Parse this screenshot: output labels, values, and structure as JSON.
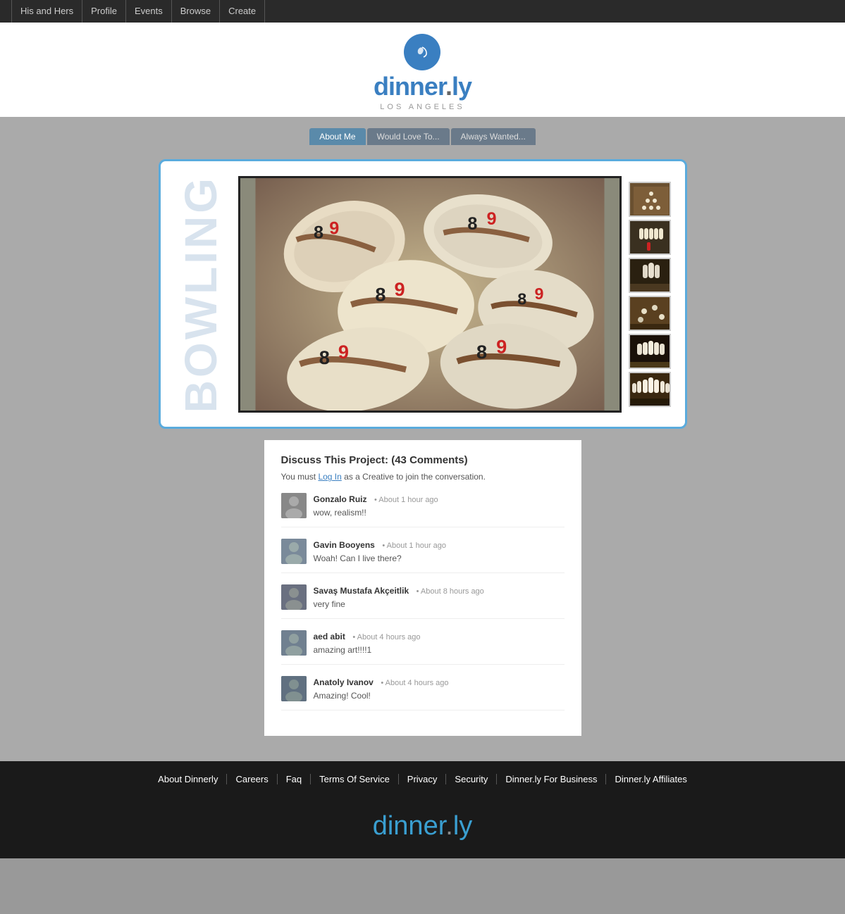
{
  "nav": {
    "brand": "His and Hers",
    "links": [
      "Profile",
      "Events",
      "Browse",
      "Create"
    ]
  },
  "header": {
    "logo_text": "dinner.ly",
    "logo_dot": ".",
    "location": "LOS ANGELES"
  },
  "profile_tabs": {
    "tabs": [
      "About Me",
      "Would Love To...",
      "Always Wanted..."
    ]
  },
  "lightbox": {
    "title": "Bowling",
    "thumbnails": [
      "thumb1",
      "thumb2",
      "thumb3",
      "thumb4",
      "thumb5",
      "thumb6"
    ]
  },
  "comments": {
    "title": "Discuss This Project: (43 Comments)",
    "login_prompt": "You must",
    "login_link": "Log In",
    "login_suffix": "as a Creative to join the conversation.",
    "items": [
      {
        "author": "Gonzalo Ruiz",
        "time": "About 1 hour ago",
        "text": "wow, realism!!"
      },
      {
        "author": "Gavin Booyens",
        "time": "About 1 hour ago",
        "text": "Woah! Can I live there?"
      },
      {
        "author": "Savaş Mustafa Akçeitlik",
        "time": "About 8 hours ago",
        "text": "very fine"
      },
      {
        "author": "aed abit",
        "time": "About 4 hours ago",
        "text": "amazing art!!!!1"
      },
      {
        "author": "Anatoly Ivanov",
        "time": "About 4 hours ago",
        "text": "Amazing! Cool!"
      }
    ]
  },
  "footer": {
    "links": [
      "About Dinnerly",
      "Careers",
      "Faq",
      "Terms Of Service",
      "Privacy",
      "Security",
      "Dinner.ly For Business",
      "Dinner.ly Affiliates"
    ],
    "logo": "dinner.ly"
  }
}
